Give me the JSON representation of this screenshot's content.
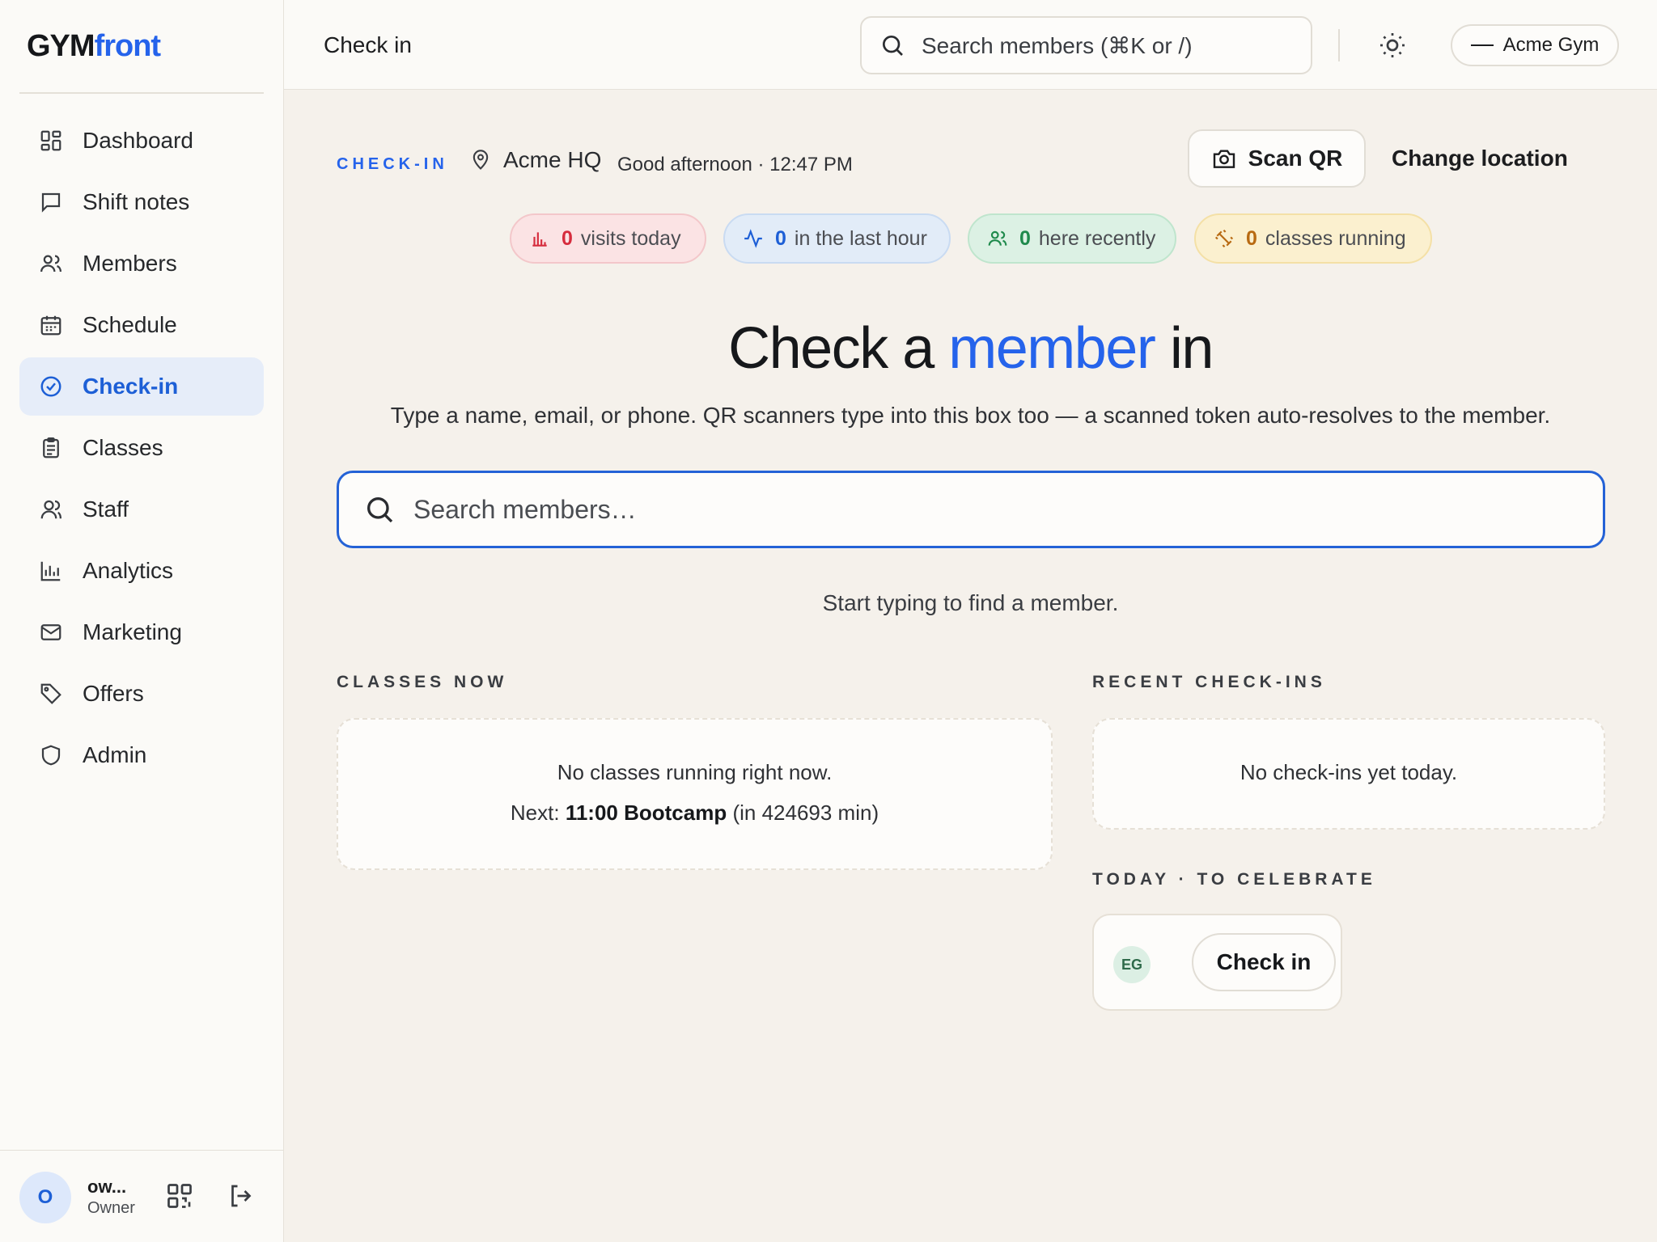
{
  "brand": {
    "part1": "GYM",
    "part2": "front"
  },
  "sidebar": {
    "items": [
      {
        "label": "Dashboard",
        "icon": "dashboard-icon"
      },
      {
        "label": "Shift notes",
        "icon": "message-square-icon"
      },
      {
        "label": "Members",
        "icon": "users-icon"
      },
      {
        "label": "Schedule",
        "icon": "calendar-icon"
      },
      {
        "label": "Check-in",
        "icon": "check-circle-icon",
        "active": true
      },
      {
        "label": "Classes",
        "icon": "clipboard-icon"
      },
      {
        "label": "Staff",
        "icon": "staff-icon"
      },
      {
        "label": "Analytics",
        "icon": "bar-chart-icon"
      },
      {
        "label": "Marketing",
        "icon": "mail-icon"
      },
      {
        "label": "Offers",
        "icon": "tag-icon"
      },
      {
        "label": "Admin",
        "icon": "shield-icon"
      }
    ],
    "user": {
      "initial": "O",
      "name": "ow...",
      "role": "Owner"
    }
  },
  "topbar": {
    "title": "Check in",
    "search_placeholder": "Search members (⌘K or /)",
    "gym": "Acme Gym"
  },
  "header": {
    "eyebrow": "CHECK-IN",
    "location": "Acme HQ",
    "greeting": "Good afternoon · 12:47 PM",
    "scan_label": "Scan QR",
    "change_location_label": "Change location"
  },
  "stats": [
    {
      "value": "0",
      "label": "visits today",
      "color": "#d62c3d"
    },
    {
      "value": "0",
      "label": "in the last hour",
      "color": "#1d5fd6"
    },
    {
      "value": "0",
      "label": "here recently",
      "color": "#1f8a4c"
    },
    {
      "value": "0",
      "label": "classes running",
      "color": "#b86a12"
    }
  ],
  "hero": {
    "before": "Check a",
    "accent": "member",
    "after": "in",
    "subtitle": "Type a name, email, or phone. QR scanners type into this box too — a scanned token auto-resolves to the member.",
    "search_placeholder": "Search members…",
    "hint": "Start typing to find a member."
  },
  "classes_now": {
    "label": "CLASSES NOW",
    "empty": "No classes running right now.",
    "next_prefix": "Next:",
    "next_class": "11:00 Bootcamp",
    "next_suffix": "(in 424693 min)"
  },
  "recent_checkins": {
    "label": "RECENT CHECK-INS",
    "empty": "No check-ins yet today."
  },
  "celebrate": {
    "label": "TODAY · TO CELEBRATE",
    "member_initials": "EG",
    "button": "Check in"
  },
  "colors": {
    "accent": "#2563eb",
    "sidebar_active_bg": "#e6edf9"
  }
}
